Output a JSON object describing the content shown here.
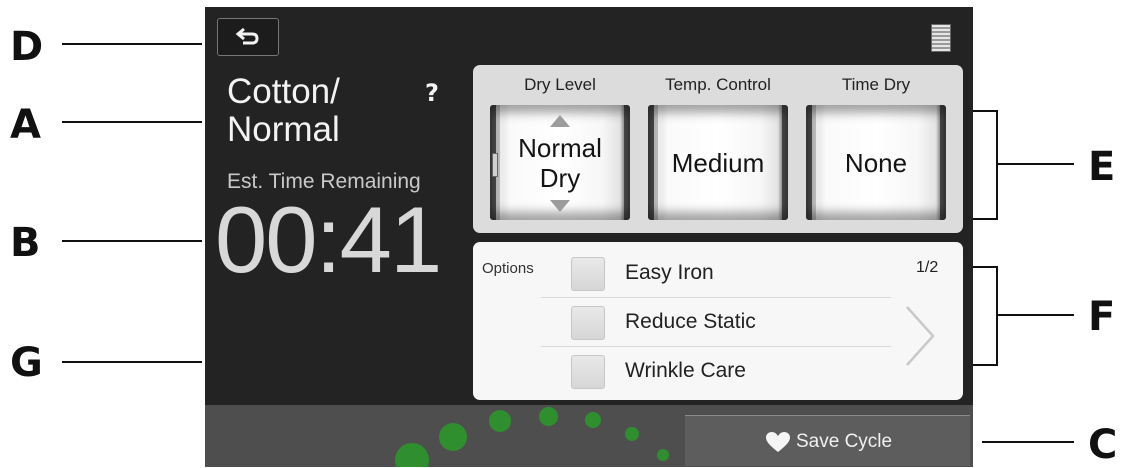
{
  "callouts": {
    "d": "D",
    "a": "A",
    "b": "B",
    "g": "G",
    "e": "E",
    "f": "F",
    "c": "C"
  },
  "header": {
    "back_icon": "back-arrow-icon",
    "menu_icon": "list-icon"
  },
  "cycle": {
    "name_line1": "Cotton/",
    "name_line2": "Normal",
    "help": "?"
  },
  "time": {
    "label": "Est. Time Remaining",
    "value": "00:41"
  },
  "controls": [
    {
      "label": "Dry Level",
      "value_line1": "Normal",
      "value_line2": "Dry"
    },
    {
      "label": "Temp. Control",
      "value_line1": "Medium",
      "value_line2": ""
    },
    {
      "label": "Time Dry",
      "value_line1": "None",
      "value_line2": ""
    }
  ],
  "options": {
    "label": "Options",
    "page": "1/2",
    "items": [
      {
        "label": "Easy Iron",
        "checked": false
      },
      {
        "label": "Reduce Static",
        "checked": false
      },
      {
        "label": "Wrinkle Care",
        "checked": false
      }
    ]
  },
  "save": {
    "label": "Save Cycle",
    "icon": "heart-icon"
  },
  "colors": {
    "screen_bg": "#232323",
    "progress_dot": "#2f8f2f",
    "panel_bg": "#dcdcdc"
  }
}
